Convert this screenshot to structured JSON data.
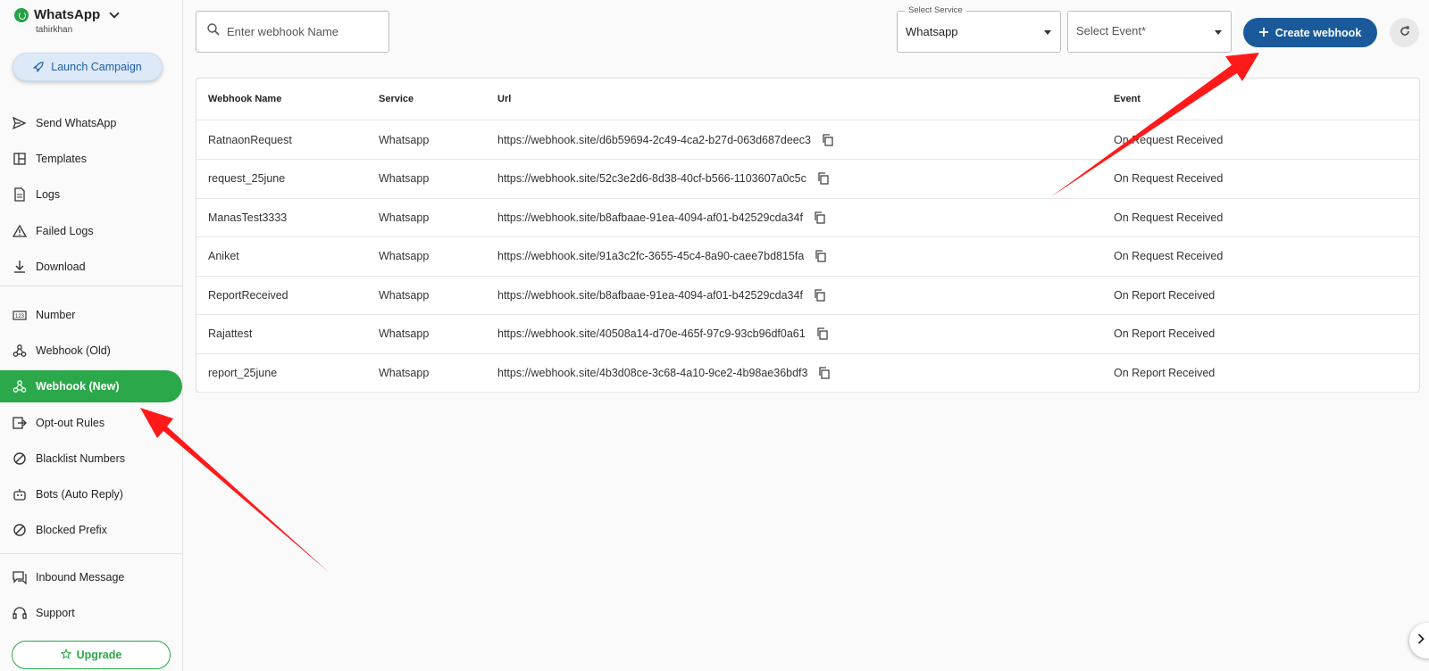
{
  "brand": {
    "title": "WhatsApp",
    "user": "tahirkhan"
  },
  "launch_label": "Launch Campaign",
  "nav": {
    "group1": [
      {
        "label": "Send WhatsApp",
        "icon": "send-icon"
      },
      {
        "label": "Templates",
        "icon": "template-icon"
      },
      {
        "label": "Logs",
        "icon": "logs-icon"
      },
      {
        "label": "Failed Logs",
        "icon": "warning-icon"
      },
      {
        "label": "Download",
        "icon": "download-icon"
      }
    ],
    "group2": [
      {
        "label": "Number",
        "icon": "number-icon"
      },
      {
        "label": "Webhook (Old)",
        "icon": "webhook-icon"
      },
      {
        "label": "Webhook (New)",
        "icon": "webhook-icon",
        "active": true
      },
      {
        "label": "Opt-out Rules",
        "icon": "exit-icon"
      },
      {
        "label": "Blacklist Numbers",
        "icon": "block-icon"
      },
      {
        "label": "Bots (Auto Reply)",
        "icon": "bot-icon"
      },
      {
        "label": "Blocked Prefix",
        "icon": "block-icon"
      }
    ],
    "group3": [
      {
        "label": "Inbound Message",
        "icon": "inbox-icon"
      },
      {
        "label": "Support",
        "icon": "headset-icon"
      }
    ]
  },
  "upgrade_label": "Upgrade",
  "search": {
    "placeholder": "Enter webhook Name",
    "value": ""
  },
  "service_select": {
    "label": "Select Service",
    "value": "Whatsapp"
  },
  "event_select": {
    "placeholder": "Select Event*"
  },
  "create_label": "Create webhook",
  "table": {
    "headers": [
      "Webhook Name",
      "Service",
      "Url",
      "Event"
    ],
    "rows": [
      {
        "name": "RatnaonRequest",
        "service": "Whatsapp",
        "url": "https://webhook.site/d6b59694-2c49-4ca2-b27d-063d687deec3",
        "event": "On Request Received"
      },
      {
        "name": "request_25june",
        "service": "Whatsapp",
        "url": "https://webhook.site/52c3e2d6-8d38-40cf-b566-1103607a0c5c",
        "event": "On Request Received"
      },
      {
        "name": "ManasTest3333",
        "service": "Whatsapp",
        "url": "https://webhook.site/b8afbaae-91ea-4094-af01-b42529cda34f",
        "event": "On Request Received"
      },
      {
        "name": "Aniket",
        "service": "Whatsapp",
        "url": "https://webhook.site/91a3c2fc-3655-45c4-8a90-caee7bd815fa",
        "event": "On Request Received"
      },
      {
        "name": "ReportReceived",
        "service": "Whatsapp",
        "url": "https://webhook.site/b8afbaae-91ea-4094-af01-b42529cda34f",
        "event": "On Report Received"
      },
      {
        "name": "Rajattest",
        "service": "Whatsapp",
        "url": "https://webhook.site/40508a14-d70e-465f-97c9-93cb96df0a61",
        "event": "On Report Received"
      },
      {
        "name": "report_25june",
        "service": "Whatsapp",
        "url": "https://webhook.site/4b3d08ce-3c68-4a10-9ce2-4b98ae36bdf3",
        "event": "On Report Received"
      }
    ]
  },
  "colors": {
    "primary": "#1a5a9b",
    "active": "#2ba84a",
    "annotation": "#ff1a1a"
  }
}
